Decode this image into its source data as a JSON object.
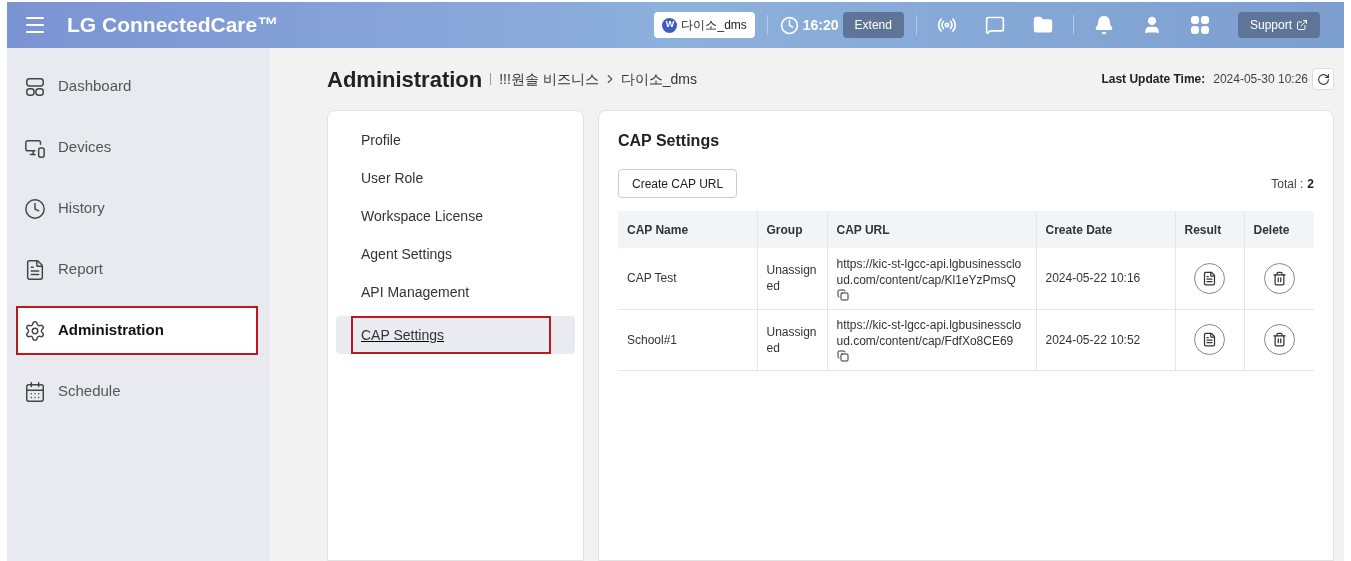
{
  "header": {
    "brand": "LG ConnectedCare™",
    "workspace": {
      "badge": "W",
      "name": "다이소_dms"
    },
    "session_time": "16:20",
    "extend_button": "Extend",
    "support_button": "Support"
  },
  "sidebar": {
    "items": [
      {
        "label": "Dashboard",
        "kind": "dashboard",
        "selected": false,
        "highlighted": false
      },
      {
        "label": "Devices",
        "kind": "devices",
        "selected": false,
        "highlighted": false
      },
      {
        "label": "History",
        "kind": "history",
        "selected": false,
        "highlighted": false
      },
      {
        "label": "Report",
        "kind": "report",
        "selected": false,
        "highlighted": false
      },
      {
        "label": "Administration",
        "kind": "settings",
        "selected": true,
        "highlighted": true
      },
      {
        "label": "Schedule",
        "kind": "schedule",
        "selected": false,
        "highlighted": false
      }
    ]
  },
  "page": {
    "title": "Administration",
    "breadcrumb": [
      "!!!원솔 비즈니스",
      "다이소_dms"
    ],
    "last_update_label": "Last Update Time:",
    "last_update_value": "2024-05-30 10:26"
  },
  "submenu": {
    "items": [
      {
        "label": "Profile",
        "selected": false,
        "highlighted": false
      },
      {
        "label": "User Role",
        "selected": false,
        "highlighted": false
      },
      {
        "label": "Workspace License",
        "selected": false,
        "highlighted": false
      },
      {
        "label": "Agent Settings",
        "selected": false,
        "highlighted": false
      },
      {
        "label": "API Management",
        "selected": false,
        "highlighted": false
      },
      {
        "label": "CAP Settings",
        "selected": true,
        "highlighted": true
      }
    ]
  },
  "panel": {
    "title": "CAP Settings",
    "create_button": "Create CAP URL",
    "total_label": "Total :",
    "total_value": "2",
    "table": {
      "columns": [
        "CAP Name",
        "Group",
        "CAP URL",
        "Create Date",
        "Result",
        "Delete"
      ],
      "rows": [
        {
          "name": "CAP Test",
          "group": "Unassigned",
          "url": "https://kic-st-lgcc-api.lgbusinesscloud.com/content/cap/Kl1eYzPmsQ",
          "date": "2024-05-22 10:16"
        },
        {
          "name": "School#1",
          "group": "Unassigned",
          "url": "https://kic-st-lgcc-api.lgbusinesscloud.com/content/cap/FdfXo8CE69",
          "date": "2024-05-22 10:52"
        }
      ]
    }
  }
}
